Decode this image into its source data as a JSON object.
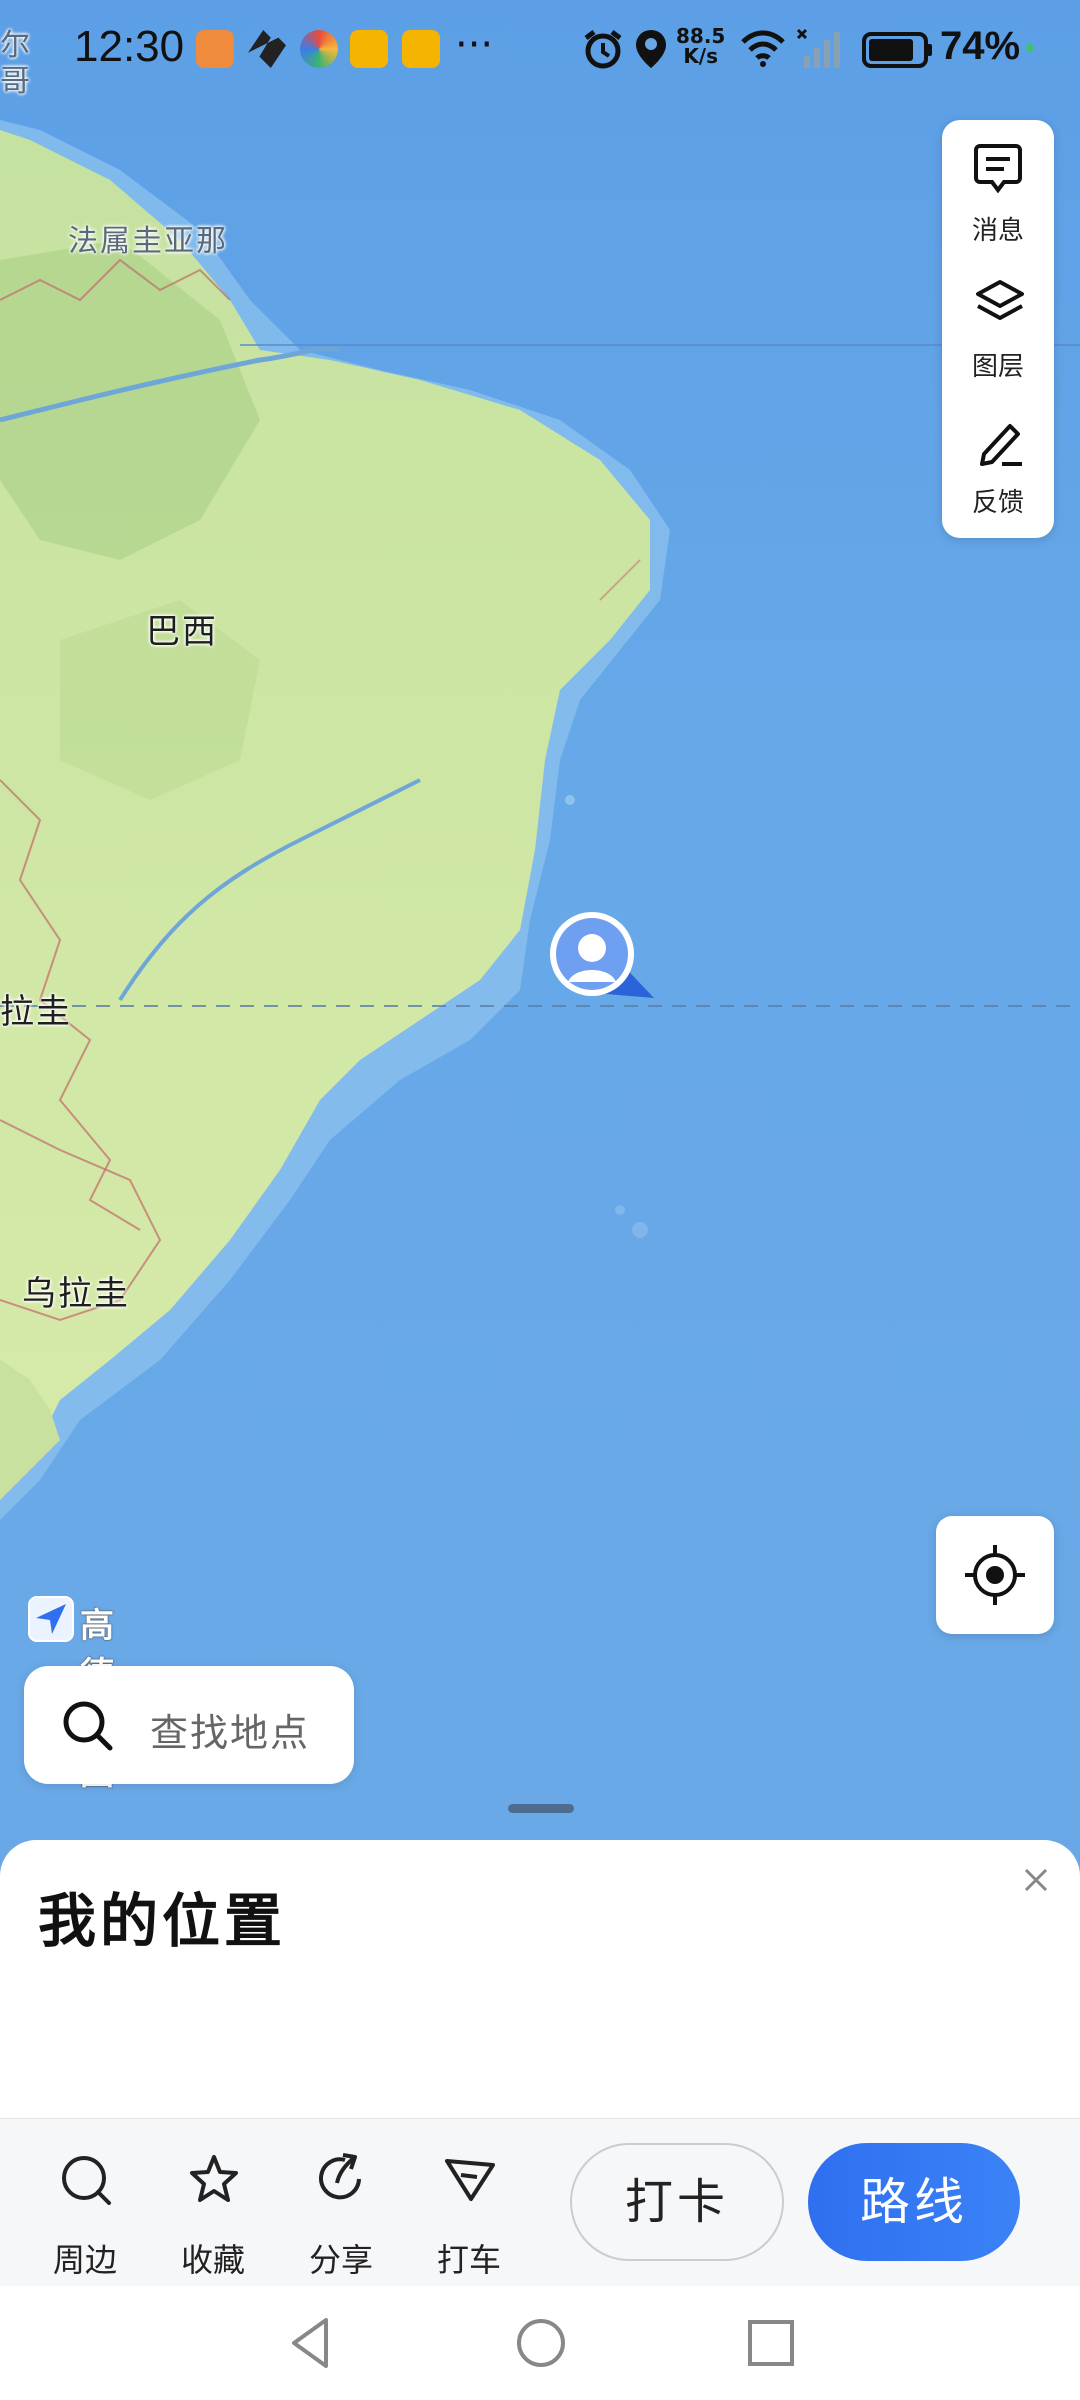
{
  "status_bar": {
    "time": "12:30",
    "more_indicator": "···",
    "network_speed_value": "88.5",
    "network_speed_unit": "K/s",
    "battery_percent": "74%",
    "icons": [
      "alarm-icon",
      "location-icon",
      "wifi-icon",
      "signal-icon",
      "battery-icon"
    ]
  },
  "map": {
    "labels": {
      "french_guiana": "法属圭亚那",
      "brazil": "巴西",
      "paraguay_partial": "拉圭",
      "uruguay": "乌拉圭",
      "edge_partial_1": "尔",
      "edge_partial_2": "哥"
    },
    "logo_text": "高德地图"
  },
  "tools": {
    "messages": "消息",
    "layers": "图层",
    "feedback": "反馈"
  },
  "search": {
    "placeholder": "查找地点"
  },
  "sheet": {
    "title": "我的位置"
  },
  "actions": {
    "nearby": "周边",
    "favorite": "收藏",
    "share": "分享",
    "taxi": "打车",
    "checkin": "打卡",
    "route": "路线"
  },
  "colors": {
    "ocean": "#66a8e8",
    "land": "#cfe6a6",
    "route_button": "#3b82f6"
  }
}
